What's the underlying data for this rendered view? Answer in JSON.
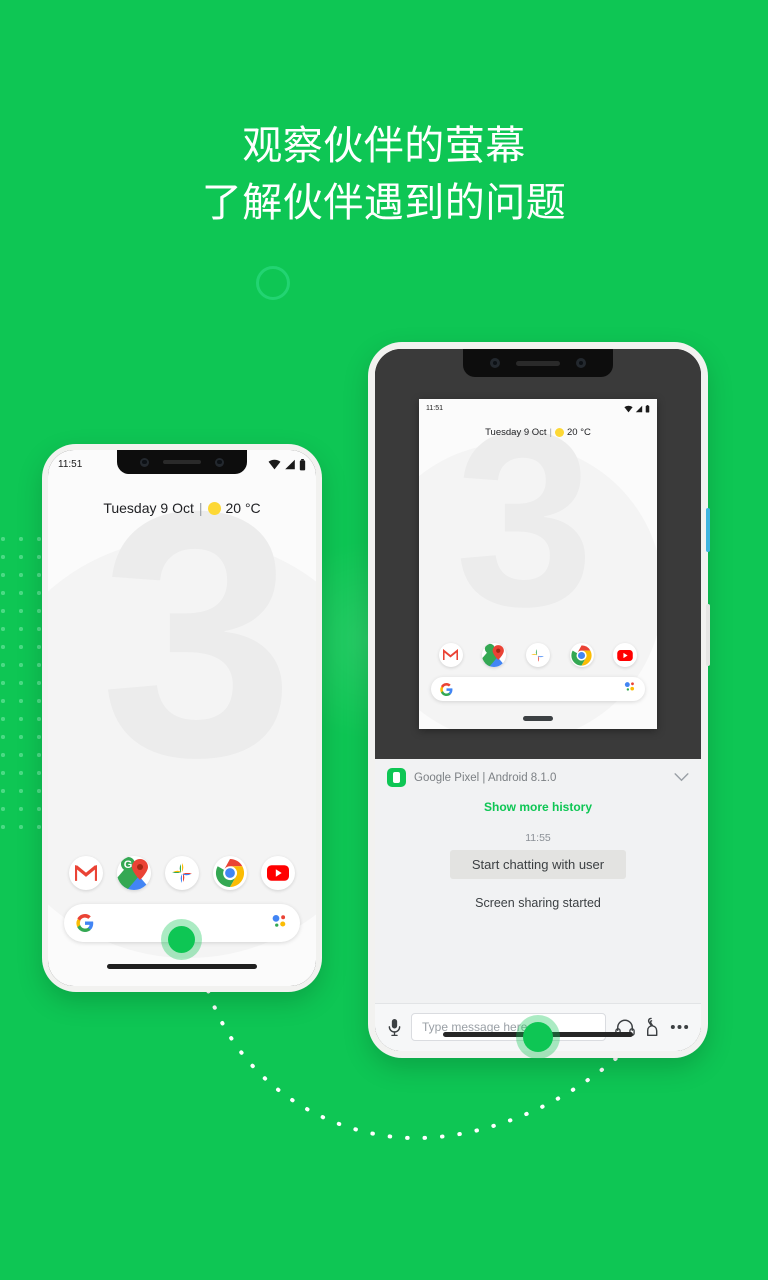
{
  "background_color": "#0ec654",
  "accent_color": "#0ec654",
  "headline": {
    "line1": "观察伙伴的萤幕",
    "line2": "了解伙伴遇到的问题"
  },
  "left_phone": {
    "name": "user-device-preview",
    "status_bar": {
      "time": "11:51",
      "wifi_icon": "wifi-icon",
      "signal_icon": "signal-icon",
      "battery_icon": "battery-icon"
    },
    "date_widget": {
      "date": "Tuesday 9 Oct",
      "separator": "|",
      "weather_icon": "sun-icon",
      "temperature": "20 °C"
    },
    "wallpaper_text": "3",
    "dock_apps": [
      {
        "name": "gmail",
        "label": "M"
      },
      {
        "name": "google-maps",
        "label": ""
      },
      {
        "name": "google-photos",
        "label": ""
      },
      {
        "name": "chrome",
        "label": ""
      },
      {
        "name": "youtube",
        "label": ""
      }
    ],
    "search_bar": {
      "logo_icon": "google-g-icon",
      "assistant_icon": "google-assistant-icon",
      "value": ""
    }
  },
  "right_phone": {
    "name": "technician-device",
    "mirrored_screen": {
      "status_bar": {
        "time": "11:51",
        "wifi_icon": "wifi-icon",
        "signal_icon": "signal-icon",
        "battery_icon": "battery-icon"
      },
      "date_widget": {
        "date": "Tuesday 9 Oct",
        "separator": "|",
        "weather_icon": "sun-icon",
        "temperature": "20 °C"
      },
      "wallpaper_text": "3",
      "dock_apps": [
        {
          "name": "gmail",
          "label": "M"
        },
        {
          "name": "google-maps",
          "label": ""
        },
        {
          "name": "google-photos",
          "label": ""
        },
        {
          "name": "chrome",
          "label": ""
        },
        {
          "name": "youtube",
          "label": ""
        }
      ],
      "search_bar": {
        "logo_icon": "google-g-icon",
        "assistant_icon": "google-assistant-icon",
        "value": ""
      }
    },
    "chat_panel": {
      "device_icon": "device-phone-icon",
      "device_label": "Google Pixel | Android 8.1.0",
      "collapse_icon": "chevron-down-icon",
      "show_more_label": "Show more history",
      "message_time": "11:55",
      "action_bubble": "Start chatting with user",
      "system_message": "Screen sharing started",
      "toolbar": {
        "mic_icon": "microphone-icon",
        "input_placeholder": "Type message here",
        "input_value": "",
        "headset_icon": "headset-icon",
        "pointer_icon": "remote-pointer-icon",
        "more_icon": "more-options-icon"
      }
    }
  }
}
